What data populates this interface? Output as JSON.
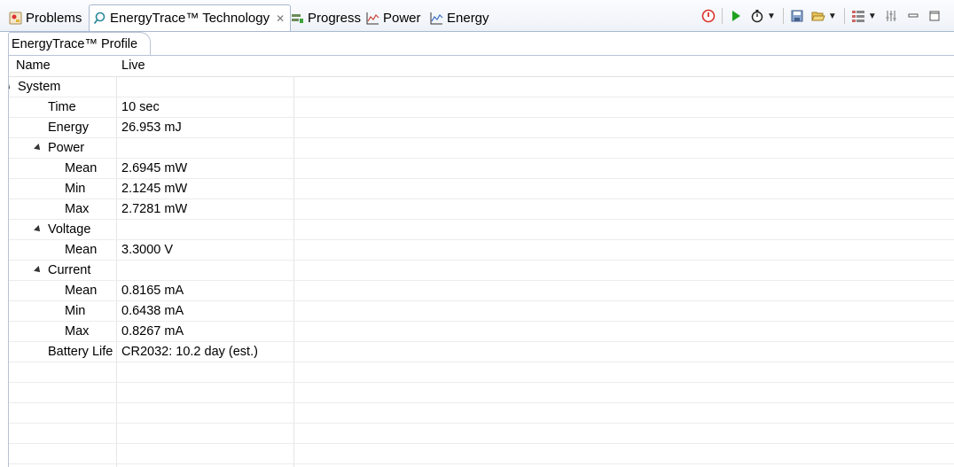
{
  "tabs": [
    {
      "label": "Problems",
      "icon": "problems-icon"
    },
    {
      "label": "EnergyTrace™ Technology",
      "icon": "energytrace-icon",
      "active": true
    },
    {
      "label": "Progress",
      "icon": "progress-icon"
    },
    {
      "label": "Power",
      "icon": "power-chart-icon"
    },
    {
      "label": "Energy",
      "icon": "energy-chart-icon"
    }
  ],
  "subtab": {
    "label": "EnergyTrace™ Profile"
  },
  "table": {
    "columns": [
      "Name",
      "Live"
    ],
    "rows": [
      {
        "name": "System",
        "live": "",
        "level": 0,
        "expanded": true
      },
      {
        "name": "Time",
        "live": "10 sec",
        "level": 1
      },
      {
        "name": "Energy",
        "live": "26.953 mJ",
        "level": 1
      },
      {
        "name": "Power",
        "live": "",
        "level": 1,
        "expanded": true
      },
      {
        "name": "Mean",
        "live": "2.6945 mW",
        "level": 2
      },
      {
        "name": "Min",
        "live": "2.1245 mW",
        "level": 2
      },
      {
        "name": "Max",
        "live": "2.7281 mW",
        "level": 2
      },
      {
        "name": "Voltage",
        "live": "",
        "level": 1,
        "expanded": true
      },
      {
        "name": "Mean",
        "live": "3.3000 V",
        "level": 2
      },
      {
        "name": "Current",
        "live": "",
        "level": 1,
        "expanded": true
      },
      {
        "name": "Mean",
        "live": "0.8165 mA",
        "level": 2
      },
      {
        "name": "Min",
        "live": "0.6438 mA",
        "level": 2
      },
      {
        "name": "Max",
        "live": "0.8267 mA",
        "level": 2
      },
      {
        "name": "Battery Life",
        "live": "CR2032: 10.2 day (est.)",
        "level": 1
      }
    ]
  },
  "colors": {
    "stop": "#d9342b",
    "run": "#1fa21f",
    "border": "#a9b8cf"
  }
}
